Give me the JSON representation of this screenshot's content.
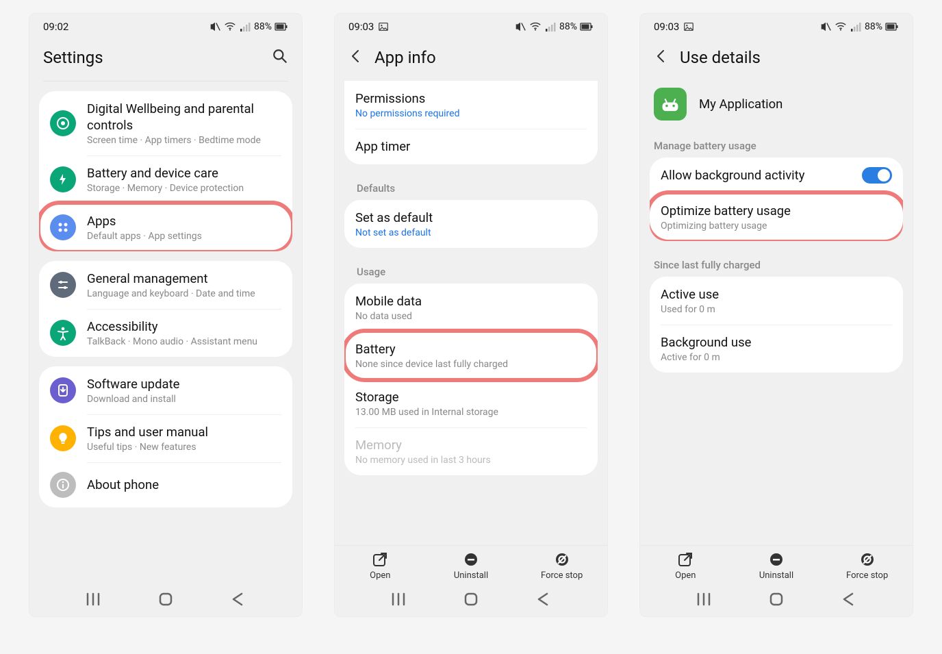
{
  "status": {
    "battery_text": "88%"
  },
  "screen1": {
    "time": "09:02",
    "title": "Settings",
    "groups": [
      {
        "items": [
          {
            "icon": "wellbeing-icon",
            "color": "#0aa678",
            "title": "Digital Wellbeing and parental controls",
            "sub": "Screen time  ·  App timers  ·  Bedtime mode"
          },
          {
            "icon": "battery-care-icon",
            "color": "#0aa678",
            "title": "Battery and device care",
            "sub": "Storage  ·  Memory  ·  Device protection"
          },
          {
            "icon": "apps-icon",
            "color": "#5b8def",
            "title": "Apps",
            "sub": "Default apps  ·  App settings",
            "highlight": true
          }
        ]
      },
      {
        "items": [
          {
            "icon": "general-icon",
            "color": "#5f6b7a",
            "title": "General management",
            "sub": "Language and keyboard  ·  Date and time"
          },
          {
            "icon": "accessibility-icon",
            "color": "#0aa678",
            "title": "Accessibility",
            "sub": "TalkBack  ·  Mono audio  ·  Assistant menu"
          }
        ]
      },
      {
        "items": [
          {
            "icon": "software-icon",
            "color": "#6b5fd0",
            "title": "Software update",
            "sub": "Download and install"
          },
          {
            "icon": "tips-icon",
            "color": "#ffb300",
            "title": "Tips and user manual",
            "sub": "Useful tips  ·  New features"
          },
          {
            "icon": "about-icon",
            "color": "#bdbdbd",
            "title": "About phone",
            "sub": ""
          }
        ]
      }
    ]
  },
  "screen2": {
    "time": "09:03",
    "title": "App info",
    "top_items": [
      {
        "title": "Permissions",
        "sub": "No permissions required",
        "link": true
      },
      {
        "title": "App timer",
        "sub": ""
      }
    ],
    "sections": [
      {
        "label": "Defaults",
        "items": [
          {
            "title": "Set as default",
            "sub": "Not set as default",
            "link": true
          }
        ]
      },
      {
        "label": "Usage",
        "items": [
          {
            "title": "Mobile data",
            "sub": "No data used"
          },
          {
            "title": "Battery",
            "sub": "None since device last fully charged",
            "highlight": true
          },
          {
            "title": "Storage",
            "sub": "13.00 MB used in Internal storage"
          },
          {
            "title": "Memory",
            "sub": "No memory used in last 3 hours",
            "faded": true
          }
        ]
      }
    ],
    "actions": [
      {
        "icon": "open-icon",
        "label": "Open"
      },
      {
        "icon": "uninstall-icon",
        "label": "Uninstall"
      },
      {
        "icon": "forcestop-icon",
        "label": "Force stop"
      }
    ]
  },
  "screen3": {
    "time": "09:03",
    "title": "Use details",
    "app_name": "My Application",
    "manage_label": "Manage battery usage",
    "manage_items": [
      {
        "title": "Allow background activity",
        "toggle": true
      },
      {
        "title": "Optimize battery usage",
        "sub": "Optimizing battery usage",
        "highlight": true
      }
    ],
    "since_label": "Since last fully charged",
    "since_items": [
      {
        "title": "Active use",
        "sub": "Used for 0 m"
      },
      {
        "title": "Background use",
        "sub": "Active for 0 m"
      }
    ],
    "actions": [
      {
        "icon": "open-icon",
        "label": "Open"
      },
      {
        "icon": "uninstall-icon",
        "label": "Uninstall"
      },
      {
        "icon": "forcestop-icon",
        "label": "Force stop"
      }
    ]
  }
}
